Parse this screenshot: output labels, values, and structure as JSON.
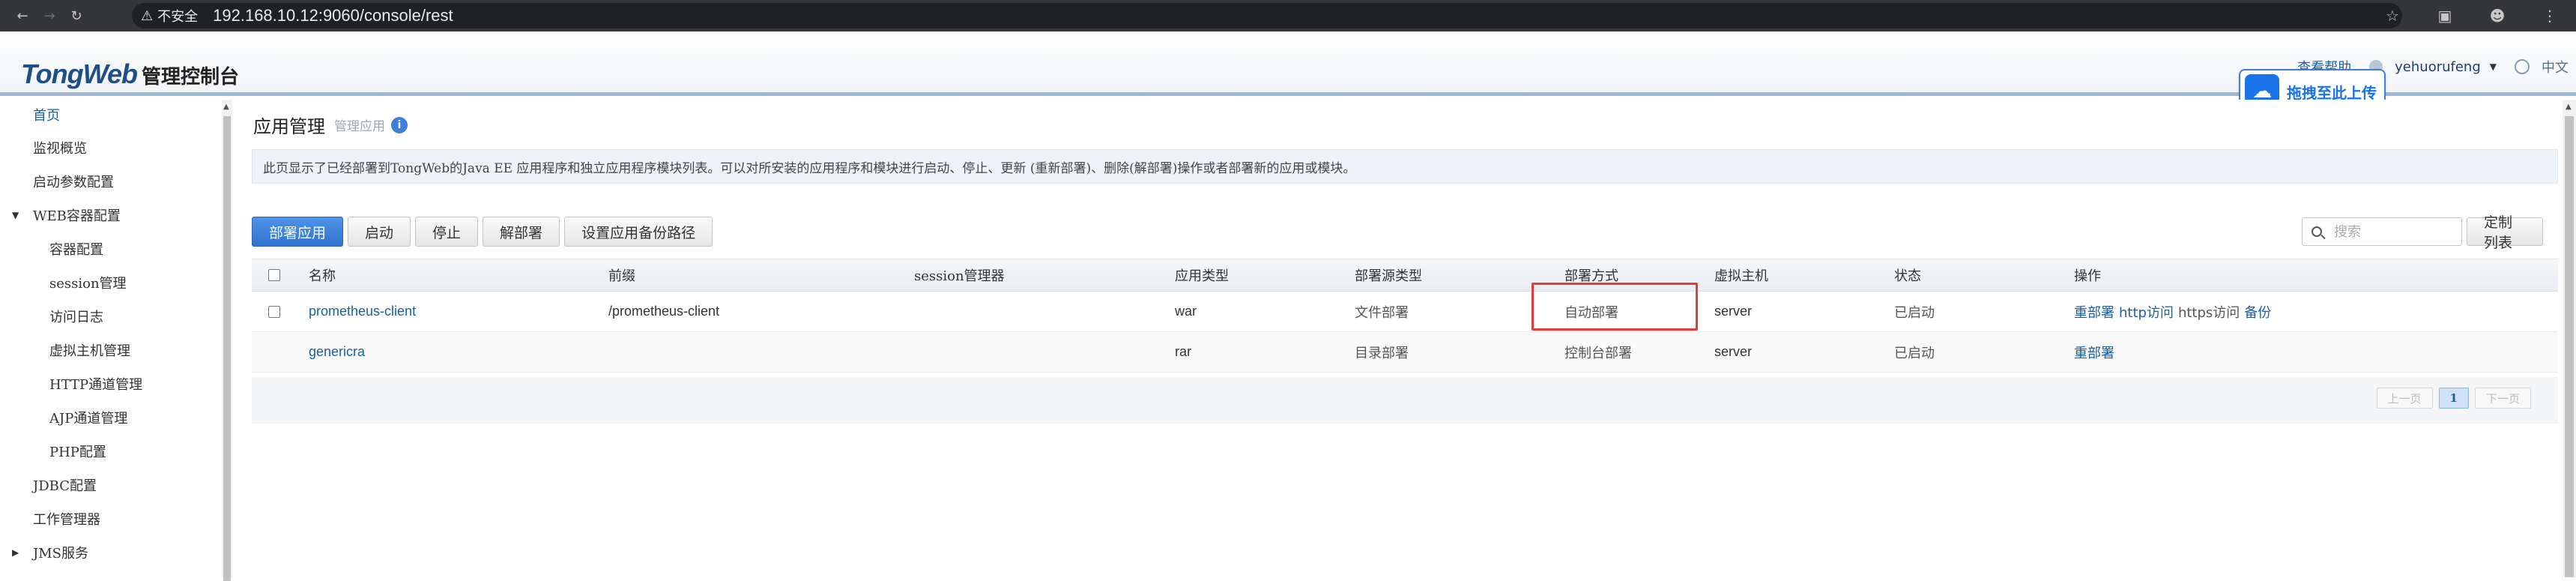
{
  "browser": {
    "insecure_label": "不安全",
    "url": "192.168.10.12:9060/console/rest"
  },
  "header": {
    "logo": "TongWeb",
    "logo_sub": "管理控制台",
    "help": "查看帮助",
    "user": "yehuorufeng",
    "lang": "中文"
  },
  "upload": {
    "label": "拖拽至此上传"
  },
  "sidebar": {
    "items": [
      {
        "label": "首页"
      },
      {
        "label": "监视概览"
      },
      {
        "label": "启动参数配置"
      },
      {
        "label": "WEB容器配置"
      },
      {
        "label": "容器配置"
      },
      {
        "label": "session管理"
      },
      {
        "label": "访问日志"
      },
      {
        "label": "虚拟主机管理"
      },
      {
        "label": "HTTP通道管理"
      },
      {
        "label": "AJP通道管理"
      },
      {
        "label": "PHP配置"
      },
      {
        "label": "JDBC配置"
      },
      {
        "label": "工作管理器"
      },
      {
        "label": "JMS服务"
      }
    ]
  },
  "page": {
    "title": "应用管理",
    "subtitle": "管理应用",
    "description": "此页显示了已经部署到TongWeb的Java EE 应用程序和独立应用程序模块列表。可以对所安装的应用程序和模块进行启动、停止、更新 (重新部署)、删除(解部署)操作或者部署新的应用或模块。"
  },
  "toolbar": {
    "deploy": "部署应用",
    "start": "启动",
    "stop": "停止",
    "undeploy": "解部署",
    "backup_path": "设置应用备份路径",
    "search_placeholder": "搜索",
    "custom_columns": "定制列表"
  },
  "table": {
    "headers": {
      "name": "名称",
      "prefix": "前缀",
      "session": "session管理器",
      "app_type": "应用类型",
      "source_type": "部署源类型",
      "deploy_mode": "部署方式",
      "vhost": "虚拟主机",
      "status": "状态",
      "ops": "操作"
    },
    "rows": [
      {
        "name": "prometheus-client",
        "prefix": "/prometheus-client",
        "session": "",
        "app_type": "war",
        "source_type": "文件部署",
        "deploy_mode": "自动部署",
        "vhost": "server",
        "status": "已启动",
        "ops": [
          "重部署",
          "http访问",
          "https访问",
          "备份"
        ]
      },
      {
        "name": "genericra",
        "prefix": "",
        "session": "",
        "app_type": "rar",
        "source_type": "目录部署",
        "deploy_mode": "控制台部署",
        "vhost": "server",
        "status": "已启动",
        "ops": [
          "重部署"
        ]
      }
    ]
  },
  "pager": {
    "prev": "上一页",
    "current": "1",
    "next": "下一页"
  },
  "colors": {
    "primary": "#2f73cf",
    "link": "#1a5fa6",
    "highlight": "#e03c3c"
  }
}
